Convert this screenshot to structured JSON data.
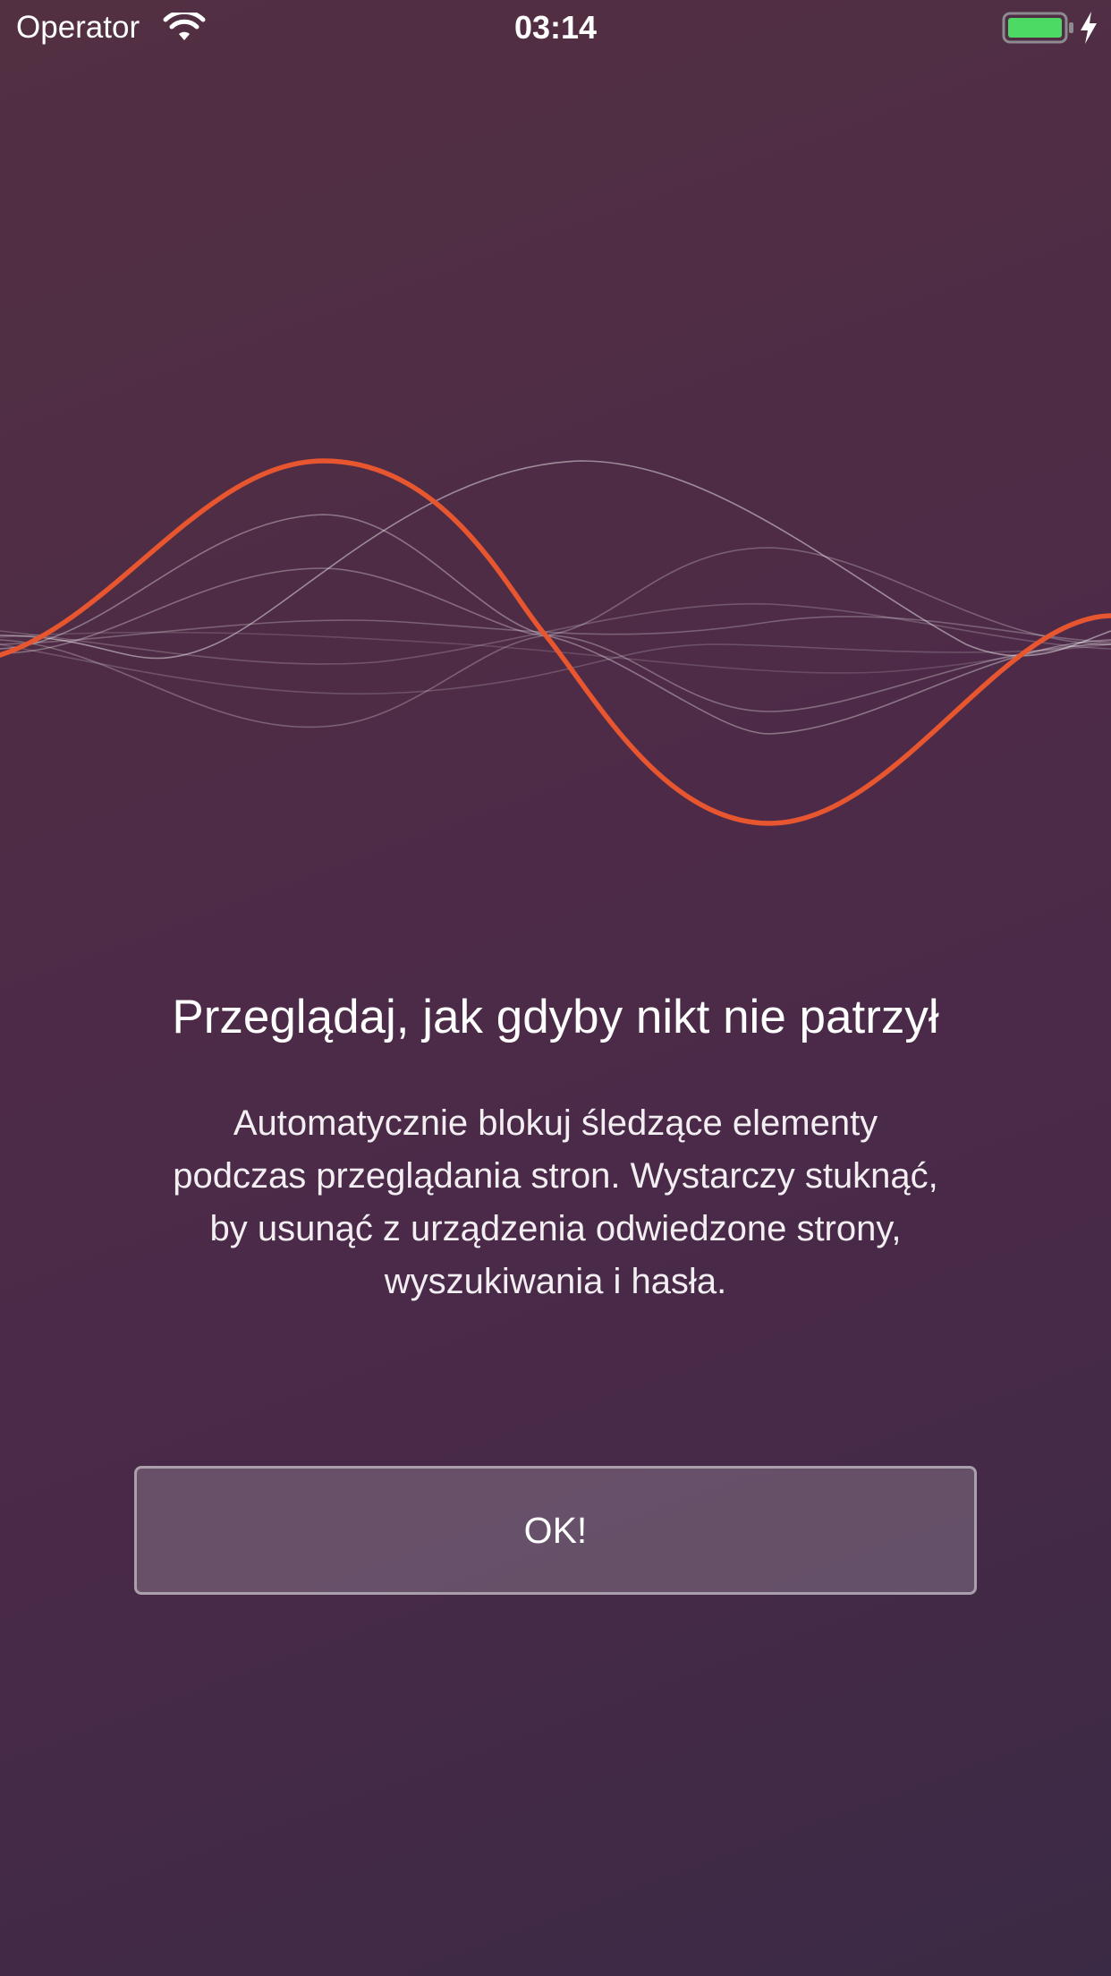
{
  "status_bar": {
    "carrier": "Operator",
    "time": "03:14",
    "battery_color": "#4cd964",
    "icons": [
      "wifi-icon",
      "battery-icon",
      "charging-bolt-icon"
    ]
  },
  "illustration": {
    "icon": "waveform-illustration",
    "accent_color": "#e8562f"
  },
  "onboarding": {
    "title": "Przeglądaj, jak gdyby nikt nie patrzył",
    "description_lines": [
      "Automatycznie blokuj śledzące elementy",
      "podczas przeglądania stron. Wystarczy stuknąć,",
      "by usunąć z urządzenia odwiedzone strony,",
      "wyszukiwania i hasła."
    ],
    "ok_button": "OK!"
  }
}
